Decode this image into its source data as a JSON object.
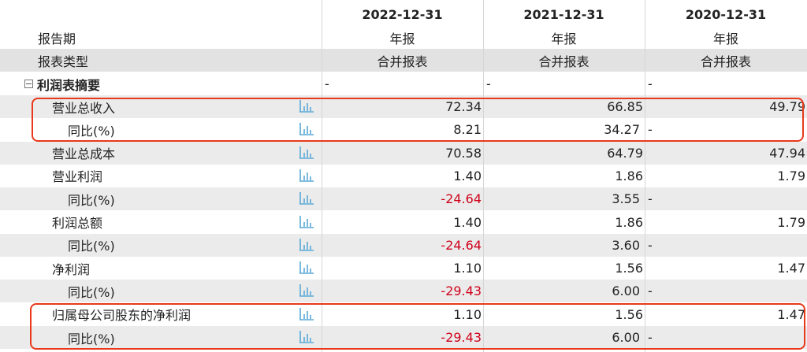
{
  "header": {
    "dates": [
      "2022-12-31",
      "2021-12-31",
      "2020-12-31"
    ],
    "report_period_label": "报告期",
    "report_periods": [
      "年报",
      "年报",
      "年报"
    ],
    "report_type_label": "报表类型",
    "report_types": [
      "合并报表",
      "合并报表",
      "合并报表"
    ]
  },
  "section": {
    "title": "利润表摘要",
    "values": [
      "-",
      "-",
      "-"
    ]
  },
  "rows": [
    {
      "label": "营业总收入",
      "values": [
        "72.34",
        "66.85",
        "49.79"
      ]
    },
    {
      "label": "同比(%)",
      "values": [
        "8.21",
        "34.27",
        "-"
      ]
    },
    {
      "label": "营业总成本",
      "values": [
        "70.58",
        "64.79",
        "47.94"
      ]
    },
    {
      "label": "营业利润",
      "values": [
        "1.40",
        "1.86",
        "1.79"
      ]
    },
    {
      "label": "同比(%)",
      "values": [
        "-24.64",
        "3.55",
        "-"
      ]
    },
    {
      "label": "利润总额",
      "values": [
        "1.40",
        "1.86",
        "1.79"
      ]
    },
    {
      "label": "同比(%)",
      "values": [
        "-24.64",
        "3.60",
        "-"
      ]
    },
    {
      "label": "净利润",
      "values": [
        "1.10",
        "1.56",
        "1.47"
      ]
    },
    {
      "label": "同比(%)",
      "values": [
        "-29.43",
        "6.00",
        "-"
      ]
    },
    {
      "label": "归属母公司股东的净利润",
      "values": [
        "1.10",
        "1.56",
        "1.47"
      ]
    },
    {
      "label": "同比(%)",
      "values": [
        "-29.43",
        "6.00",
        "-"
      ]
    }
  ],
  "icons": {
    "row_chart": "bar-chart-icon",
    "collapse": "collapse-minus-icon"
  },
  "colors": {
    "negative": "#d0021b",
    "highlight": "#e8391b",
    "icon": "#5aa9d6"
  }
}
